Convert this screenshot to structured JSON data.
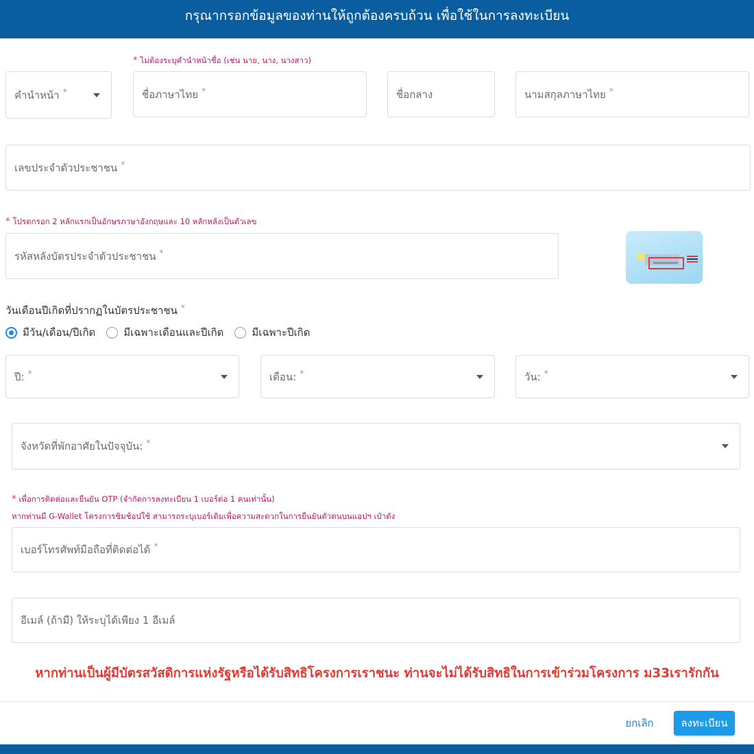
{
  "header": {
    "title": "กรุณากรอกข้อมูลของท่านให้ถูกต้องครบถ้วน เพื่อใช้ในการลงทะเบียน"
  },
  "name_note": "ไม่ต้องระบุคำนำหน้าชื่อ (เช่น นาย, นาง, นางสาว)",
  "fields": {
    "prefix": "คำนำหน้า",
    "first_name": "ชื่อภาษาไทย",
    "middle_name": "ชื่อกลาง",
    "last_name": "นามสกุลภาษาไทย",
    "citizen_id": "เลขประจำตัวประชาชน",
    "laser_code": "รหัสหลังบัตรประจำตัวประชาชน",
    "year": "ปี:",
    "month": "เดือน:",
    "day": "วัน:",
    "province": "จังหวัดที่พักอาศัยในปัจจุบัน:",
    "phone": "เบอร์โทรศัพท์มือถือที่ติดต่อได้",
    "email": "อีเมล์ (ถ้ามี) ให้ระบุได้เพียง 1 อีเมล์"
  },
  "required_mark": "*",
  "laser_note": "โปรดกรอก 2 หลักแรกเป็นอักษรภาษาอังกฤษและ 10 หลักหลังเป็นตัวเลข",
  "dob": {
    "label": "วันเดือนปีเกิดที่ปรากฏในบัตรประชาชน",
    "options": [
      "มีวัน/เดือน/ปีเกิด",
      "มีเฉพาะเดือนและปีเกิด",
      "มีเฉพาะปีเกิด"
    ],
    "selected_index": 0
  },
  "phone_note": "เพื่อการติดต่อและยืนยัน OTP (จำกัดการลงทะเบียน 1 เบอร์ต่อ 1 คนเท่านั้น)",
  "gwallet_note": "หากท่านมี G-Wallet โครงการชิมช้อปใช้ สามารถระบุเบอร์เดิมเพื่อความสะดวกในการยืนยันตัวตนบนแอปฯ เป๋าตัง",
  "warning": "หากท่านเป็นผู้มีบัตรสวัสดิการแห่งรัฐหรือได้รับสิทธิโครงการเราชนะ ท่านจะไม่ได้รับสิทธิในการเข้าร่วมโครงการ ม33เรารักกัน",
  "buttons": {
    "cancel": "ยกเลิก",
    "submit": "ลงทะเบียน"
  },
  "colors": {
    "header": "#0a5d9e",
    "accent": "#1e88e5",
    "warning": "#e53935",
    "note": "#c2185b"
  }
}
